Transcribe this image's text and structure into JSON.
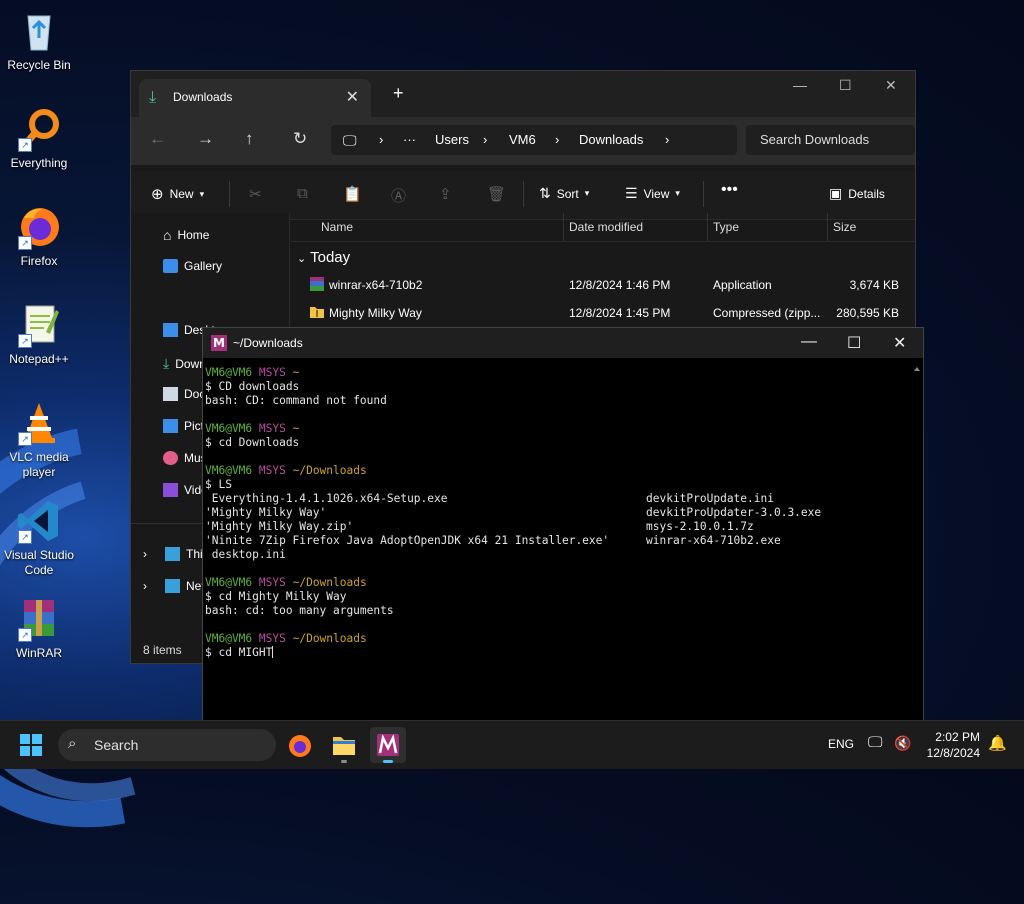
{
  "desktop": {
    "icons": [
      {
        "label": "Recycle Bin",
        "icon": "recycle-bin-icon"
      },
      {
        "label": "Everything",
        "icon": "everything-search-icon"
      },
      {
        "label": "Firefox",
        "icon": "firefox-icon"
      },
      {
        "label": "Notepad++",
        "icon": "notepad-plus-plus-icon"
      },
      {
        "label": "VLC media player",
        "icon": "vlc-icon"
      },
      {
        "label": "Visual Studio Code",
        "icon": "vscode-icon"
      },
      {
        "label": "WinRAR",
        "icon": "winrar-icon"
      }
    ]
  },
  "explorer": {
    "tab_title": "Downloads",
    "address": [
      "Users",
      "VM6",
      "Downloads"
    ],
    "search_placeholder": "Search Downloads",
    "commands": {
      "new": "New",
      "sort": "Sort",
      "view": "View",
      "details": "Details"
    },
    "sidebar": {
      "home": "Home",
      "gallery": "Gallery",
      "desktop": "Desktop",
      "downloads": "Downloads",
      "documents": "Documents",
      "pictures": "Pictures",
      "music": "Music",
      "videos": "Videos",
      "this_pc": "This PC",
      "network": "Network"
    },
    "columns": {
      "name": "Name",
      "date": "Date modified",
      "type": "Type",
      "size": "Size"
    },
    "group": "Today",
    "files": [
      {
        "name": "winrar-x64-710b2",
        "date": "12/8/2024 1:46 PM",
        "type": "Application",
        "size": "3,674 KB"
      },
      {
        "name": "Mighty Milky Way",
        "date": "12/8/2024 1:45 PM",
        "type": "Compressed (zipp...",
        "size": "280,595 KB"
      }
    ],
    "status": "8 items"
  },
  "terminal": {
    "title": "~/Downloads",
    "user": "VM6@VM6",
    "env": "MSYS",
    "lines": {
      "p1": "~",
      "c1": "$ CD downloads",
      "o1": "bash: CD: command not found",
      "p2": "~",
      "c2": "$ cd Downloads",
      "p3": "~/Downloads",
      "c3": "$ LS",
      "ls1a": " Everything-1.4.1.1026.x64-Setup.exe",
      "ls1b": "devkitProUpdate.ini",
      "ls2a": "'Mighty Milky Way'",
      "ls2b": "devkitProUpdater-3.0.3.exe",
      "ls3a": "'Mighty Milky Way.zip'",
      "ls3b": "msys-2.10.0.1.7z",
      "ls4a": "'Ninite 7Zip Firefox Java AdoptOpenJDK x64 21 Installer.exe'",
      "ls4b": "winrar-x64-710b2.exe",
      "ls5a": " desktop.ini",
      "p4": "~/Downloads",
      "c4": "$ cd Mighty Milky Way",
      "o4": "bash: cd: too many arguments",
      "p5": "~/Downloads",
      "c5": "$ cd MIGHT"
    }
  },
  "taskbar": {
    "search": "Search",
    "lang": "ENG",
    "time": "2:02 PM",
    "date": "12/8/2024"
  }
}
